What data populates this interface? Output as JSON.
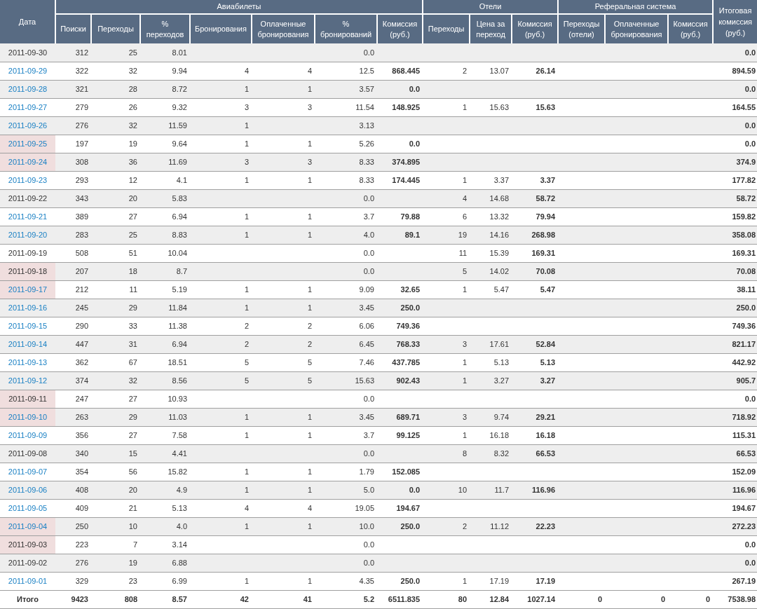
{
  "table": {
    "corner_header": "Дата",
    "groups": [
      {
        "label": "Авиабилеты",
        "columns": [
          "Поиски",
          "Переходы",
          "%\nпереходов",
          "Бронирования",
          "Оплаченные бронирования",
          "%\nбронирований",
          "Комиссия (руб.)"
        ]
      },
      {
        "label": "Отели",
        "columns": [
          "Переходы",
          "Цена за переход",
          "Комиссия (руб.)"
        ]
      },
      {
        "label": "Реферальная система",
        "columns": [
          "Переходы (отели)",
          "Оплаченные бронирования",
          "Комиссия (руб.)"
        ]
      }
    ],
    "last_header": "Итоговая комиссия (руб.)",
    "rows": [
      {
        "date": "2011-09-30",
        "link": false,
        "weekend": false,
        "cells": [
          "312",
          "25",
          "8.01",
          null,
          null,
          "0.0",
          null,
          null,
          null,
          null,
          null,
          null,
          null
        ],
        "total": "0.0"
      },
      {
        "date": "2011-09-29",
        "link": true,
        "weekend": false,
        "cells": [
          "322",
          "32",
          "9.94",
          "4",
          "4",
          "12.5",
          "868.445",
          "2",
          "13.07",
          "26.14",
          null,
          null,
          null
        ],
        "total": "894.59"
      },
      {
        "date": "2011-09-28",
        "link": true,
        "weekend": false,
        "cells": [
          "321",
          "28",
          "8.72",
          "1",
          "1",
          "3.57",
          "0.0",
          null,
          null,
          null,
          null,
          null,
          null
        ],
        "total": "0.0"
      },
      {
        "date": "2011-09-27",
        "link": true,
        "weekend": false,
        "cells": [
          "279",
          "26",
          "9.32",
          "3",
          "3",
          "11.54",
          "148.925",
          "1",
          "15.63",
          "15.63",
          null,
          null,
          null
        ],
        "total": "164.55"
      },
      {
        "date": "2011-09-26",
        "link": true,
        "weekend": false,
        "cells": [
          "276",
          "32",
          "11.59",
          "1",
          null,
          "3.13",
          null,
          null,
          null,
          null,
          null,
          null,
          null
        ],
        "total": "0.0"
      },
      {
        "date": "2011-09-25",
        "link": true,
        "weekend": true,
        "cells": [
          "197",
          "19",
          "9.64",
          "1",
          "1",
          "5.26",
          "0.0",
          null,
          null,
          null,
          null,
          null,
          null
        ],
        "total": "0.0"
      },
      {
        "date": "2011-09-24",
        "link": true,
        "weekend": true,
        "cells": [
          "308",
          "36",
          "11.69",
          "3",
          "3",
          "8.33",
          "374.895",
          null,
          null,
          null,
          null,
          null,
          null
        ],
        "total": "374.9"
      },
      {
        "date": "2011-09-23",
        "link": true,
        "weekend": false,
        "cells": [
          "293",
          "12",
          "4.1",
          "1",
          "1",
          "8.33",
          "174.445",
          "1",
          "3.37",
          "3.37",
          null,
          null,
          null
        ],
        "total": "177.82"
      },
      {
        "date": "2011-09-22",
        "link": false,
        "weekend": false,
        "cells": [
          "343",
          "20",
          "5.83",
          null,
          null,
          "0.0",
          null,
          "4",
          "14.68",
          "58.72",
          null,
          null,
          null
        ],
        "total": "58.72"
      },
      {
        "date": "2011-09-21",
        "link": true,
        "weekend": false,
        "cells": [
          "389",
          "27",
          "6.94",
          "1",
          "1",
          "3.7",
          "79.88",
          "6",
          "13.32",
          "79.94",
          null,
          null,
          null
        ],
        "total": "159.82"
      },
      {
        "date": "2011-09-20",
        "link": true,
        "weekend": false,
        "cells": [
          "283",
          "25",
          "8.83",
          "1",
          "1",
          "4.0",
          "89.1",
          "19",
          "14.16",
          "268.98",
          null,
          null,
          null
        ],
        "total": "358.08"
      },
      {
        "date": "2011-09-19",
        "link": false,
        "weekend": false,
        "cells": [
          "508",
          "51",
          "10.04",
          null,
          null,
          "0.0",
          null,
          "11",
          "15.39",
          "169.31",
          null,
          null,
          null
        ],
        "total": "169.31"
      },
      {
        "date": "2011-09-18",
        "link": false,
        "weekend": true,
        "cells": [
          "207",
          "18",
          "8.7",
          null,
          null,
          "0.0",
          null,
          "5",
          "14.02",
          "70.08",
          null,
          null,
          null
        ],
        "total": "70.08"
      },
      {
        "date": "2011-09-17",
        "link": true,
        "weekend": true,
        "cells": [
          "212",
          "11",
          "5.19",
          "1",
          "1",
          "9.09",
          "32.65",
          "1",
          "5.47",
          "5.47",
          null,
          null,
          null
        ],
        "total": "38.11"
      },
      {
        "date": "2011-09-16",
        "link": true,
        "weekend": false,
        "cells": [
          "245",
          "29",
          "11.84",
          "1",
          "1",
          "3.45",
          "250.0",
          null,
          null,
          null,
          null,
          null,
          null
        ],
        "total": "250.0"
      },
      {
        "date": "2011-09-15",
        "link": true,
        "weekend": false,
        "cells": [
          "290",
          "33",
          "11.38",
          "2",
          "2",
          "6.06",
          "749.36",
          null,
          null,
          null,
          null,
          null,
          null
        ],
        "total": "749.36"
      },
      {
        "date": "2011-09-14",
        "link": true,
        "weekend": false,
        "cells": [
          "447",
          "31",
          "6.94",
          "2",
          "2",
          "6.45",
          "768.33",
          "3",
          "17.61",
          "52.84",
          null,
          null,
          null
        ],
        "total": "821.17"
      },
      {
        "date": "2011-09-13",
        "link": true,
        "weekend": false,
        "cells": [
          "362",
          "67",
          "18.51",
          "5",
          "5",
          "7.46",
          "437.785",
          "1",
          "5.13",
          "5.13",
          null,
          null,
          null
        ],
        "total": "442.92"
      },
      {
        "date": "2011-09-12",
        "link": true,
        "weekend": false,
        "cells": [
          "374",
          "32",
          "8.56",
          "5",
          "5",
          "15.63",
          "902.43",
          "1",
          "3.27",
          "3.27",
          null,
          null,
          null
        ],
        "total": "905.7"
      },
      {
        "date": "2011-09-11",
        "link": false,
        "weekend": true,
        "cells": [
          "247",
          "27",
          "10.93",
          null,
          null,
          "0.0",
          null,
          null,
          null,
          null,
          null,
          null,
          null
        ],
        "total": "0.0"
      },
      {
        "date": "2011-09-10",
        "link": true,
        "weekend": true,
        "cells": [
          "263",
          "29",
          "11.03",
          "1",
          "1",
          "3.45",
          "689.71",
          "3",
          "9.74",
          "29.21",
          null,
          null,
          null
        ],
        "total": "718.92"
      },
      {
        "date": "2011-09-09",
        "link": true,
        "weekend": false,
        "cells": [
          "356",
          "27",
          "7.58",
          "1",
          "1",
          "3.7",
          "99.125",
          "1",
          "16.18",
          "16.18",
          null,
          null,
          null
        ],
        "total": "115.31"
      },
      {
        "date": "2011-09-08",
        "link": false,
        "weekend": false,
        "cells": [
          "340",
          "15",
          "4.41",
          null,
          null,
          "0.0",
          null,
          "8",
          "8.32",
          "66.53",
          null,
          null,
          null
        ],
        "total": "66.53"
      },
      {
        "date": "2011-09-07",
        "link": true,
        "weekend": false,
        "cells": [
          "354",
          "56",
          "15.82",
          "1",
          "1",
          "1.79",
          "152.085",
          null,
          null,
          null,
          null,
          null,
          null
        ],
        "total": "152.09"
      },
      {
        "date": "2011-09-06",
        "link": true,
        "weekend": false,
        "cells": [
          "408",
          "20",
          "4.9",
          "1",
          "1",
          "5.0",
          "0.0",
          "10",
          "11.7",
          "116.96",
          null,
          null,
          null
        ],
        "total": "116.96"
      },
      {
        "date": "2011-09-05",
        "link": true,
        "weekend": false,
        "cells": [
          "409",
          "21",
          "5.13",
          "4",
          "4",
          "19.05",
          "194.67",
          null,
          null,
          null,
          null,
          null,
          null
        ],
        "total": "194.67"
      },
      {
        "date": "2011-09-04",
        "link": true,
        "weekend": true,
        "cells": [
          "250",
          "10",
          "4.0",
          "1",
          "1",
          "10.0",
          "250.0",
          "2",
          "11.12",
          "22.23",
          null,
          null,
          null
        ],
        "total": "272.23"
      },
      {
        "date": "2011-09-03",
        "link": false,
        "weekend": true,
        "cells": [
          "223",
          "7",
          "3.14",
          null,
          null,
          "0.0",
          null,
          null,
          null,
          null,
          null,
          null,
          null
        ],
        "total": "0.0"
      },
      {
        "date": "2011-09-02",
        "link": false,
        "weekend": false,
        "cells": [
          "276",
          "19",
          "6.88",
          null,
          null,
          "0.0",
          null,
          null,
          null,
          null,
          null,
          null,
          null
        ],
        "total": "0.0"
      },
      {
        "date": "2011-09-01",
        "link": true,
        "weekend": false,
        "cells": [
          "329",
          "23",
          "6.99",
          "1",
          "1",
          "4.35",
          "250.0",
          "1",
          "17.19",
          "17.19",
          null,
          null,
          null
        ],
        "total": "267.19"
      }
    ],
    "totals": {
      "label": "Итого",
      "cells": [
        "9423",
        "808",
        "8.57",
        "42",
        "41",
        "5.2",
        "6511.835",
        "80",
        "12.84",
        "1027.14",
        "0",
        "0",
        "0"
      ],
      "total": "7538.98"
    }
  }
}
